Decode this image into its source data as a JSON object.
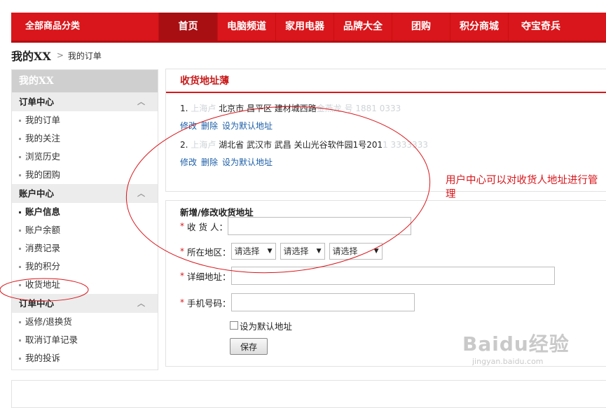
{
  "header": {
    "all_categories": "全部商品分类",
    "nav": [
      {
        "label": "首页",
        "active": true
      },
      {
        "label": "电脑频道",
        "active": false
      },
      {
        "label": "家用电器",
        "active": false
      },
      {
        "label": "品牌大全",
        "active": false
      },
      {
        "label": "团购",
        "active": false
      },
      {
        "label": "积分商城",
        "active": false
      },
      {
        "label": "夺宝奇兵",
        "active": false
      }
    ]
  },
  "breadcrumb": {
    "title": "我的XX",
    "separator": ">",
    "current": "我的订单"
  },
  "sidebar": {
    "title": "我的XX",
    "groups": [
      {
        "label": "订单中心",
        "items": [
          {
            "label": "我的订单"
          },
          {
            "label": "我的关注"
          },
          {
            "label": "浏览历史"
          },
          {
            "label": "我的团购"
          }
        ]
      },
      {
        "label": "账户中心",
        "items": [
          {
            "label": "账户信息",
            "bold": true
          },
          {
            "label": "账户余额"
          },
          {
            "label": "消费记录"
          },
          {
            "label": "我的积分"
          },
          {
            "label": "收货地址"
          }
        ]
      },
      {
        "label": "订单中心",
        "items": [
          {
            "label": "返修/退换货"
          },
          {
            "label": "取消订单记录"
          },
          {
            "label": "我的投诉"
          }
        ]
      }
    ]
  },
  "address_book": {
    "title": "收货地址薄",
    "addresses": [
      {
        "index": "1.",
        "name_blurred": "上海卢",
        "text": "北京市  昌平区  建材城西路",
        "tail_blurred": "金燕龙        号  1881  0333"
      },
      {
        "index": "2.",
        "name_blurred": "上海卢",
        "text": "湖北省  武汉市  武昌  关山光谷软件园1号201",
        "tail_blurred": "1  3333333"
      }
    ],
    "actions": {
      "edit": "修改",
      "delete": "删除",
      "set_default": "设为默认地址"
    }
  },
  "form": {
    "title": "新增/修改收货地址",
    "receiver_label": "收 货 人：",
    "region_label": "所在地区：",
    "region_select_placeholder": "请选择",
    "detail_label": "详细地址：",
    "phone_label": "手机号码：",
    "default_checkbox_label": "设为默认地址",
    "save_button": "保存",
    "required_mark": "*"
  },
  "annotation": {
    "text": "用户中心可以对收货人地址进行管理"
  },
  "watermark": {
    "main": "Baidu经验",
    "sub": "jingyan.baidu.com"
  },
  "colors": {
    "brand_red": "#d9161b",
    "nav_active": "#a80f12",
    "link_blue": "#1d5fa8",
    "annotation_red": "#d9161b"
  }
}
